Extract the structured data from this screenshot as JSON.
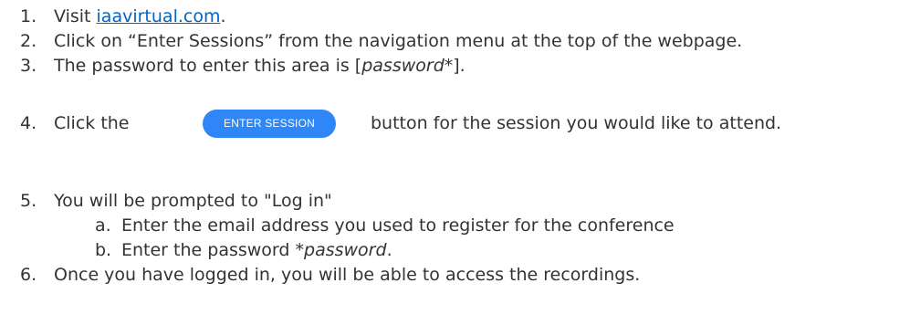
{
  "colors": {
    "text": "#333333",
    "link": "#0563c1",
    "button": "#2f86f6"
  },
  "steps": [
    {
      "number": "1.",
      "prefix": "Visit ",
      "link": "iaavirtual.com",
      "suffix": "."
    },
    {
      "number": "2.",
      "text": "Click on “Enter Sessions” from the navigation menu at the top of the webpage."
    },
    {
      "number": "3.",
      "prefix": "The password to enter this area is [",
      "emphasis": "password*",
      "suffix": "]."
    },
    {
      "number": "4.",
      "prefix": "Click the",
      "button_label": "ENTER SESSION",
      "suffix": "button for the session you would like to attend."
    },
    {
      "number": "5.",
      "text": "You will be prompted to \"Log in\"",
      "substeps": [
        {
          "letter": "a.",
          "text": "Enter the email address you used to register for the conference"
        },
        {
          "letter": "b.",
          "prefix": "Enter the password ",
          "emphasis": "*password",
          "suffix": "."
        }
      ]
    },
    {
      "number": "6.",
      "text": "Once you have logged in, you will be able to access the recordings."
    }
  ]
}
